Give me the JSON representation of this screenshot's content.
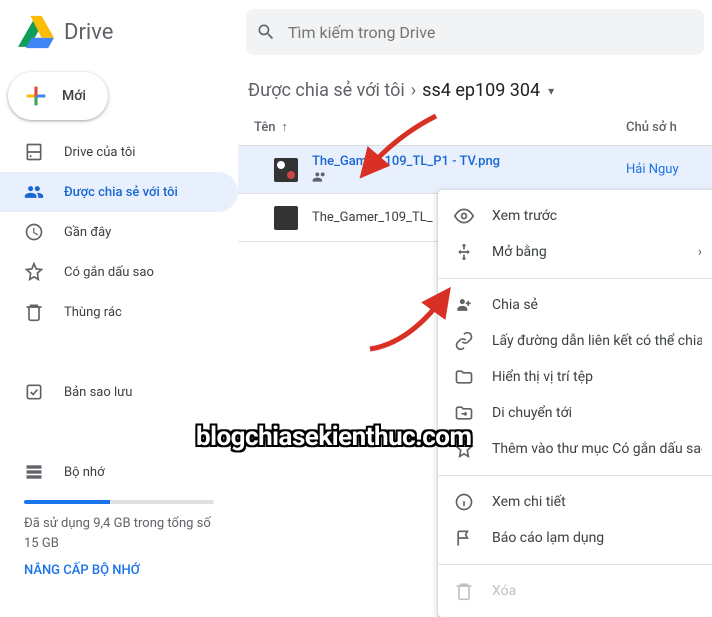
{
  "header": {
    "app_name": "Drive",
    "search_placeholder": "Tìm kiếm trong Drive"
  },
  "new_button": {
    "label": "Mới"
  },
  "sidebar": {
    "items": [
      {
        "label": "Drive của tôi"
      },
      {
        "label": "Được chia sẻ với tôi"
      },
      {
        "label": "Gần đây"
      },
      {
        "label": "Có gắn dấu sao"
      },
      {
        "label": "Thùng rác"
      },
      {
        "label": "Bản sao lưu"
      }
    ],
    "storage": {
      "label": "Bộ nhớ",
      "used_text": "Đã sử dụng 9,4 GB trong tổng số 15 GB",
      "upgrade": "NÂNG CẤP BỘ NHỚ"
    }
  },
  "breadcrumb": {
    "root": "Được chia sẻ với tôi",
    "current": "ss4 ep109 304"
  },
  "list": {
    "col_name": "Tên",
    "col_owner": "Chủ sở h",
    "rows": [
      {
        "name": "The_Gamer_109_TL_P1 - TV.png",
        "owner": "Hải Nguy"
      },
      {
        "name": "The_Gamer_109_TL_",
        "owner": ""
      }
    ]
  },
  "menu": {
    "preview": "Xem trước",
    "open_with": "Mở bằng",
    "share": "Chia sẻ",
    "get_link": "Lấy đường dẫn liên kết có thể chia sẻ",
    "show_location": "Hiển thị vị trí tệp",
    "move_to": "Di chuyển tới",
    "add_star": "Thêm vào thư mục Có gắn dấu sao",
    "details": "Xem chi tiết",
    "report": "Báo cáo lạm dụng",
    "delete": "Xóa"
  },
  "watermark": "blogchiasekienthuc.com"
}
